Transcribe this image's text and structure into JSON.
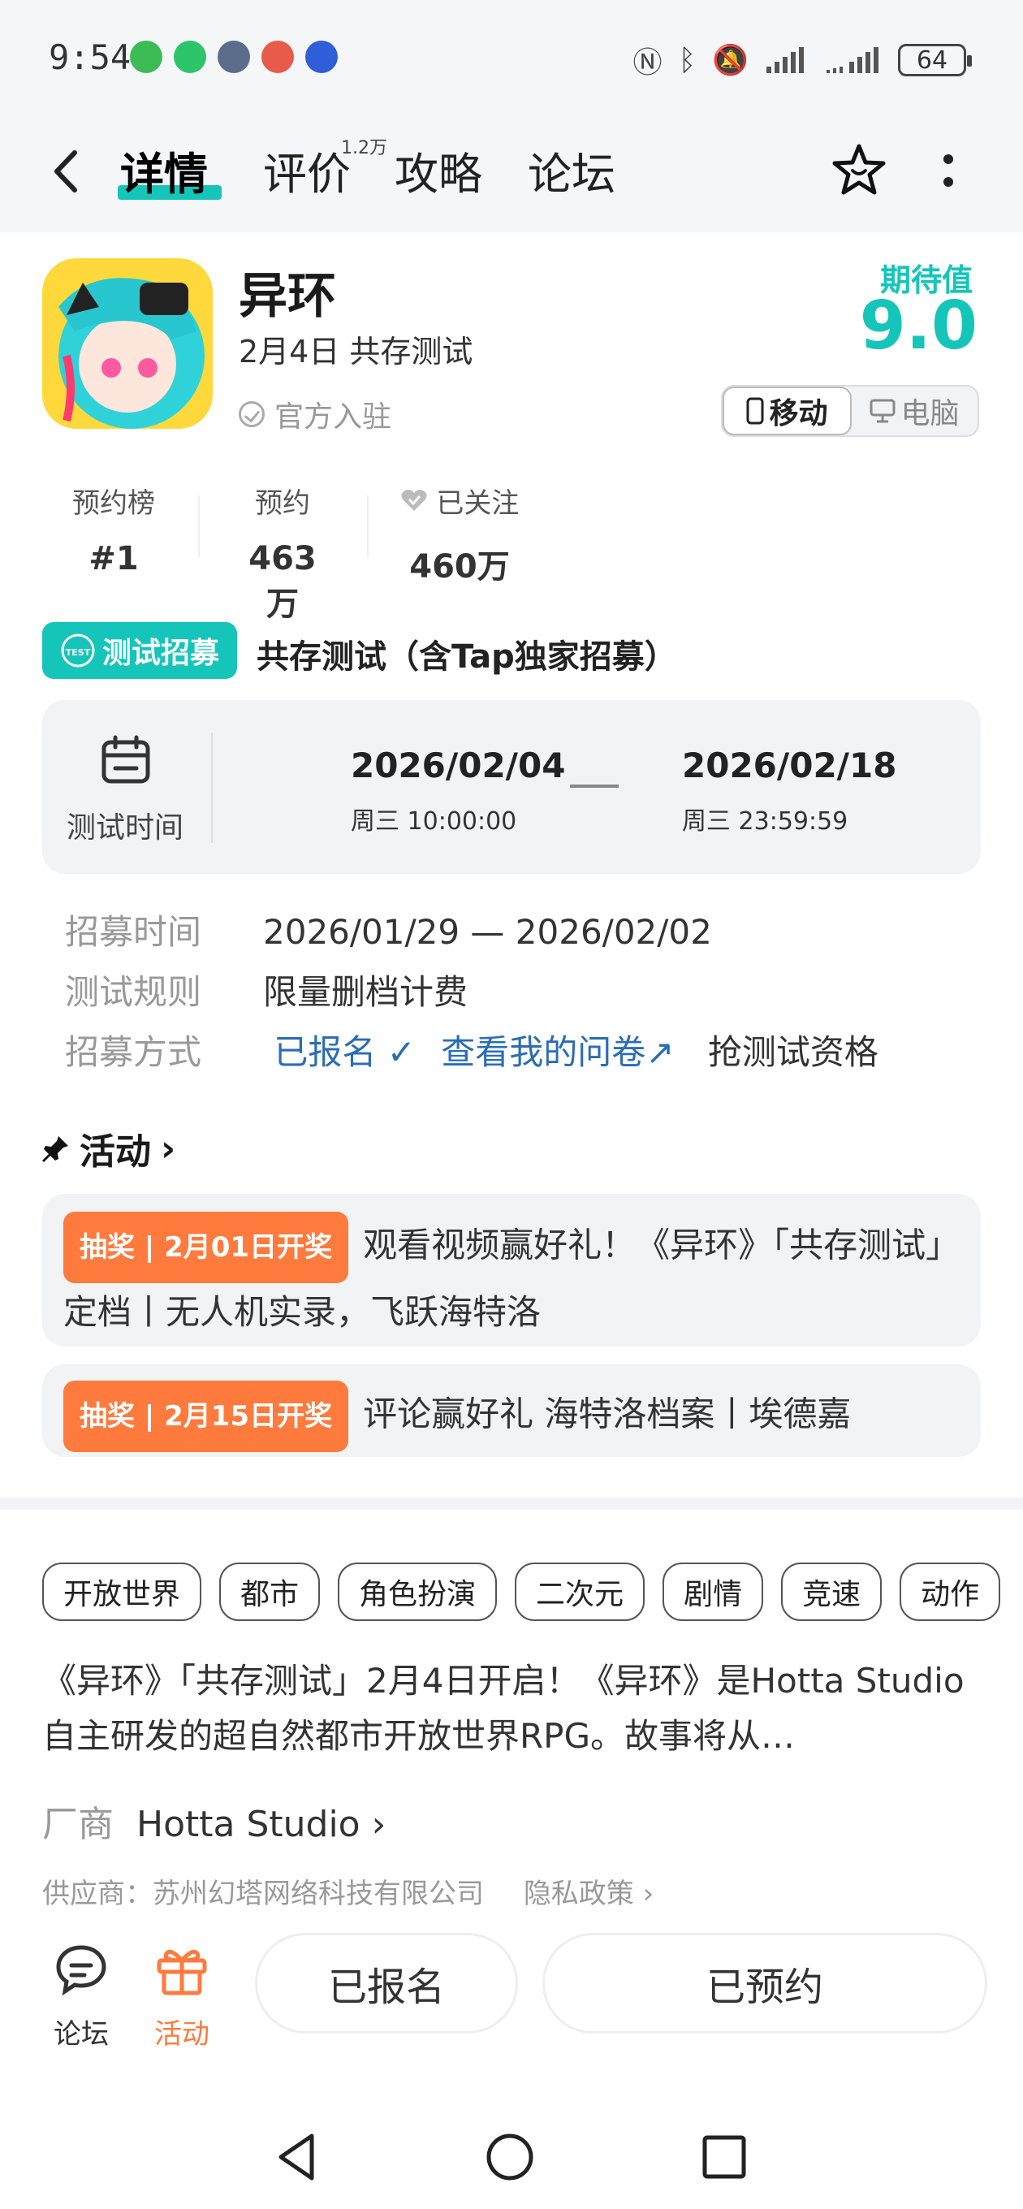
{
  "status_bar": {
    "time": "9:54",
    "battery": "64"
  },
  "nav": {
    "tabs": [
      {
        "label": "详情",
        "active": true
      },
      {
        "label": "评价",
        "badge": "1.2万"
      },
      {
        "label": "攻略"
      },
      {
        "label": "论坛"
      }
    ]
  },
  "game": {
    "title": "异环",
    "subtitle": "2月4日 共存测试",
    "official": "官方入驻",
    "expect_label": "期待值",
    "expect_value": "9.0",
    "platforms": {
      "mobile": "移动",
      "pc": "电脑"
    }
  },
  "stats": [
    {
      "label": "预约榜",
      "value": "#1"
    },
    {
      "label": "预约",
      "value": "463万"
    },
    {
      "label": "已关注",
      "value": "460万"
    }
  ],
  "test": {
    "badge": "测试招募",
    "badge_icon_text": "TEST",
    "title": "共存测试（含Tap独家招募）",
    "time_label": "测试时间",
    "start_date": "2026/02/04",
    "start_time": "周三  10:00:00",
    "end_date": "2026/02/18",
    "end_time": "周三  23:59:59",
    "recruit_time_label": "招募时间",
    "recruit_time": "2026/01/29 — 2026/02/02",
    "rule_label": "测试规则",
    "rule": "限量删档计费",
    "method_label": "招募方式",
    "signed_up": "已报名",
    "view_survey": "查看我的问卷",
    "grab": "抢测试资格"
  },
  "activities": {
    "header": "活动",
    "items": [
      {
        "tag": "抽奖 | 2月01日开奖",
        "text": "观看视频赢好礼！《异环》「共存测试」定档丨无人机实录，飞跃海特洛"
      },
      {
        "tag": "抽奖 | 2月15日开奖",
        "text": "评论赢好礼 海特洛档案丨埃德嘉"
      }
    ]
  },
  "tags": [
    "开放世界",
    "都市",
    "角色扮演",
    "二次元",
    "剧情",
    "竞速",
    "动作"
  ],
  "description": "《异环》「共存测试」2月4日开启！《异环》是Hotta Studio自主研发的超自然都市开放世界RPG。故事将从…",
  "vendor": {
    "label": "厂商",
    "name": "Hotta Studio"
  },
  "supplier": {
    "text": "供应商：苏州幻塔网络科技有限公司",
    "privacy": "隐私政策"
  },
  "bottom": {
    "forum": "论坛",
    "activity": "活动",
    "btn_signed": "已报名",
    "btn_reserved": "已预约"
  },
  "colors": {
    "accent": "#15c5ba",
    "orange": "#ff7a3d",
    "link": "#2a6db5"
  }
}
